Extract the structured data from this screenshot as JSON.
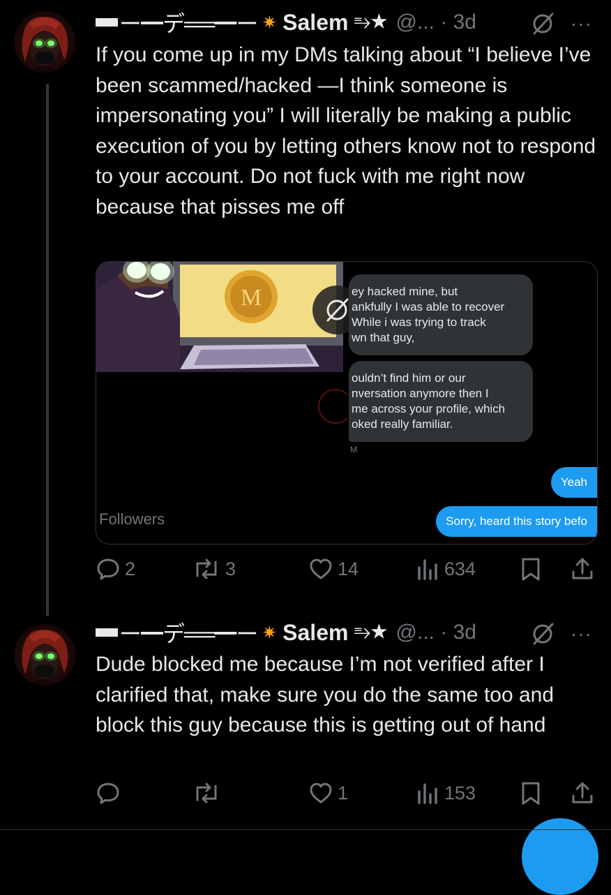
{
  "tweets": [
    {
      "name_prefix": "ー━デ══━ー",
      "name": "Salem",
      "name_suffix": "⥱★",
      "handle": "@...",
      "time": "3d",
      "text": "If you come up in my DMs talking about “I believe I’ve been scammed/hacked —I think someone is impersonating you” I will literally be making a public execution of you by letting others know not to respond to your account. Do not fuck with me right now because that pisses me off",
      "card": {
        "footer_label": "Followers",
        "messages_in": [
          "ey hacked mine, but\nankfully I was able to recover\nWhile i was trying to track\nwn that guy,",
          "ouldn’t find him or our\nnversation anymore then I\nme across your profile, which\noked really familiar."
        ],
        "msg_time": "M",
        "messages_out": [
          "Yeah",
          "Sorry, heard this story befo"
        ],
        "image_alt_icon": "grok-icon"
      },
      "actions": {
        "replies": "2",
        "reposts": "3",
        "likes": "14",
        "views": "634"
      }
    },
    {
      "name_prefix": "ー━デ══━ー",
      "name": "Salem",
      "name_suffix": "⥱★",
      "handle": "@...",
      "time": "3d",
      "text": "Dude blocked me because I’m not verified after I clarified that, make sure you do the same too and block this guy because this is getting out of hand",
      "actions": {
        "replies": "",
        "reposts": "",
        "likes": "1",
        "views": "153"
      }
    }
  ],
  "colors": {
    "background": "#000000",
    "text": "#e7e9ea",
    "muted": "#71767b",
    "accent": "#1d9bf0",
    "border": "#2f3336"
  }
}
